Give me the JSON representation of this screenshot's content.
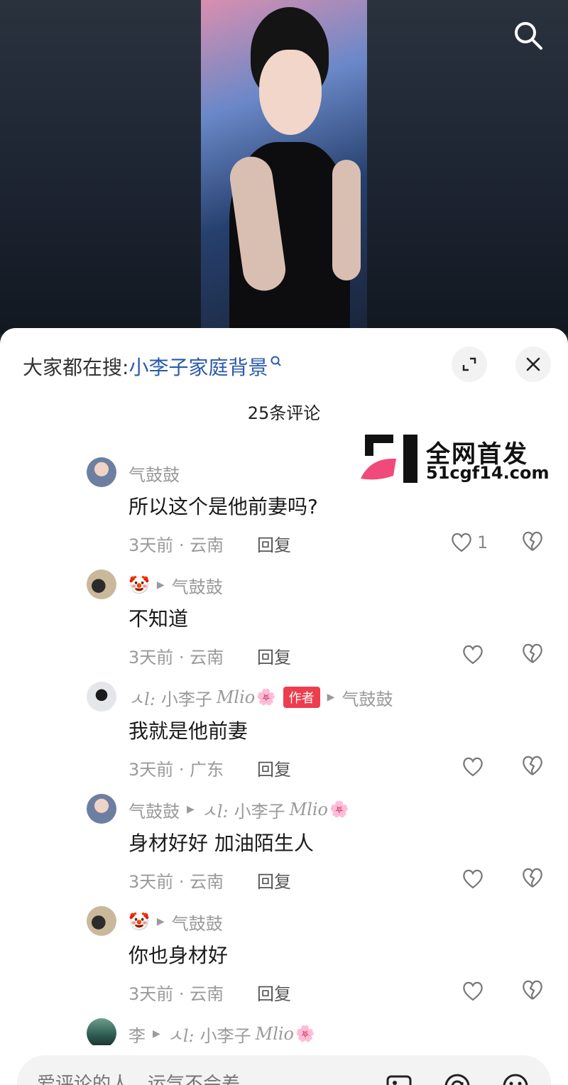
{
  "header": {
    "search_icon": "search-icon"
  },
  "sheet": {
    "search_prefix": "大家都在搜:",
    "search_term": "小李子家庭背景",
    "comment_count": "25条评论",
    "expand_icon": "expand-icon",
    "close_icon": "close-icon"
  },
  "watermark": {
    "title": "全网首发",
    "url": "51cgf14.com"
  },
  "comments": [
    {
      "author": "气鼓鼓",
      "text": "所以这个是他前妻吗?",
      "time_location": "3天前 · 云南",
      "reply": "回复",
      "likes": "1"
    },
    {
      "author_emoji": "🤡",
      "reply_to": "气鼓鼓",
      "text": "不知道",
      "time_location": "3天前 · 云南",
      "reply": "回复"
    },
    {
      "author_prefix": "ㅅl:",
      "author_name": "小李子",
      "author_suffix": "Mlio",
      "author_flower": "🌸",
      "author_tag": "作者",
      "reply_to": "气鼓鼓",
      "text": "我就是他前妻",
      "time_location": "3天前 · 广东",
      "reply": "回复"
    },
    {
      "author": "气鼓鼓",
      "reply_to_prefix": "ㅅl:",
      "reply_to_name": "小李子",
      "reply_to_suffix": "Mlio",
      "reply_to_flower": "🌸",
      "text": "身材好好 加油陌生人",
      "time_location": "3天前 · 云南",
      "reply": "回复"
    },
    {
      "author_emoji": "🤡",
      "reply_to": "气鼓鼓",
      "text": "你也身材好",
      "time_location": "3天前 · 云南",
      "reply": "回复"
    },
    {
      "author": "李",
      "reply_to_prefix": "ㅅl:",
      "reply_to_name": "小李子",
      "reply_to_suffix": "Mlio",
      "reply_to_flower": "🌸"
    }
  ],
  "input": {
    "placeholder": "爱评论的人，运气不会差",
    "image_icon": "image-icon",
    "mention_icon": "at-icon",
    "emoji_icon": "emoji-icon"
  },
  "colors": {
    "link_blue": "#2a5aa8",
    "author_tag_red": "#ee3d4d",
    "meta_gray": "#9a9a9a"
  }
}
